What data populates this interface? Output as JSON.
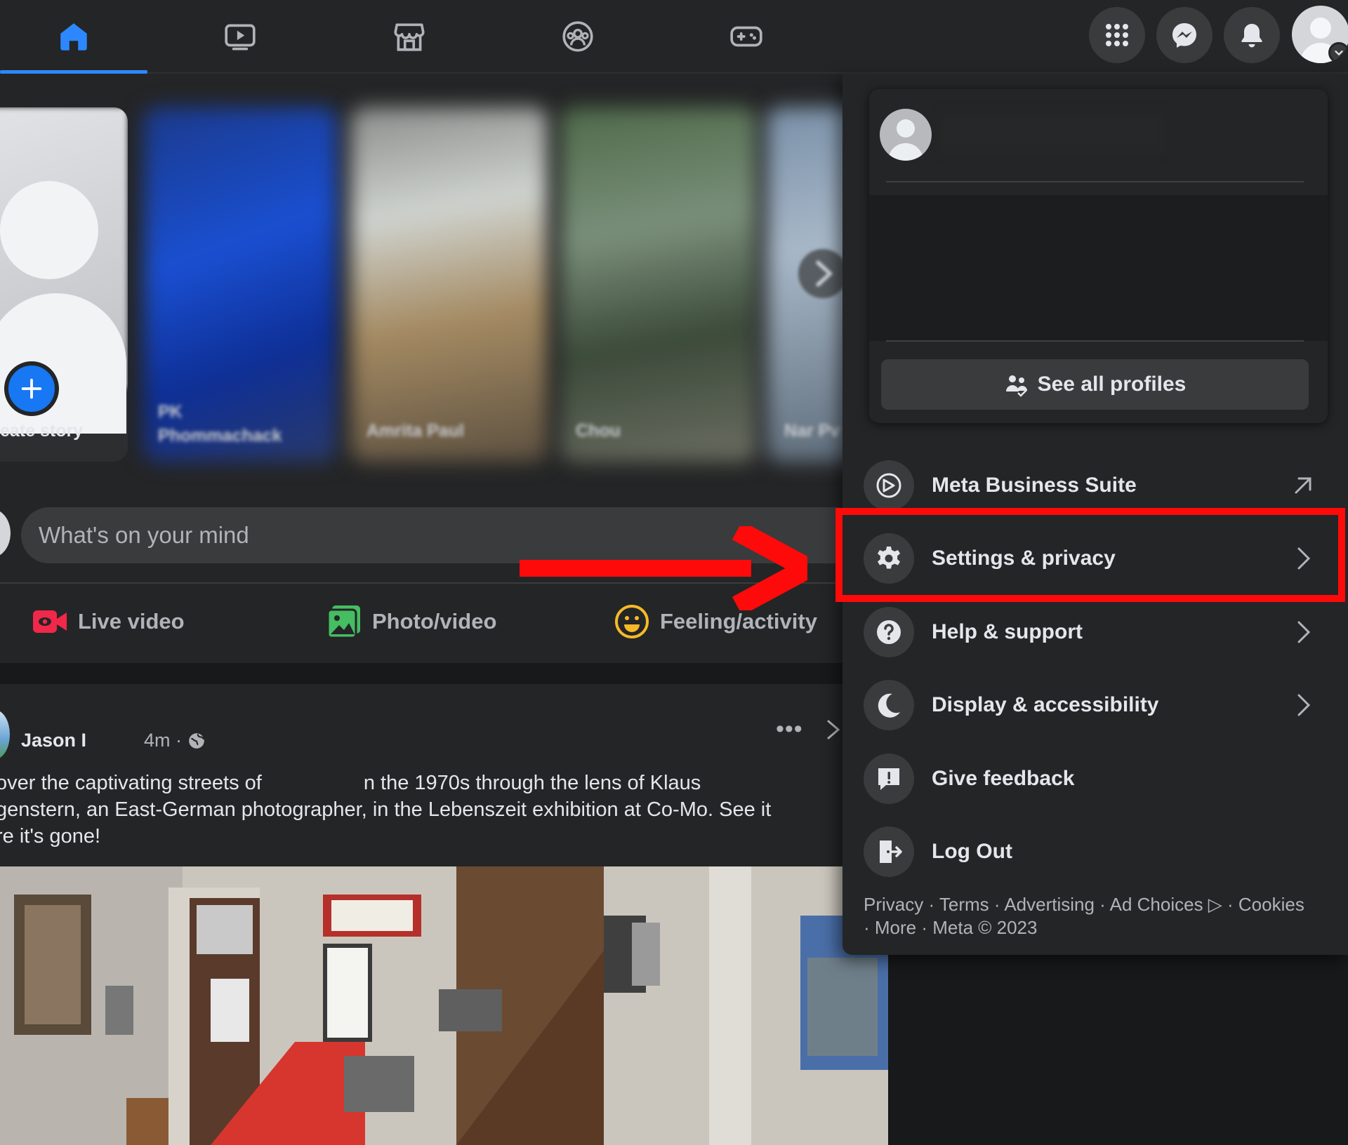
{
  "nav": {
    "tabs": [
      {
        "name": "home",
        "active": true
      },
      {
        "name": "watch",
        "active": false
      },
      {
        "name": "marketplace",
        "active": false
      },
      {
        "name": "groups",
        "active": false
      },
      {
        "name": "gaming",
        "active": false
      }
    ],
    "right_buttons": [
      "menu-grid-icon",
      "messenger-icon",
      "notifications-bell-icon",
      "account-avatar"
    ]
  },
  "stories": {
    "create_label": "eate story",
    "names": [
      "PK\nPhommachack",
      "Amrita Paul",
      "Chou",
      "Nar Pv"
    ]
  },
  "composer": {
    "placeholder": "What's on your mind",
    "actions": [
      {
        "label": "Live video",
        "icon": "live-video-icon",
        "color": "#f02849"
      },
      {
        "label": "Photo/video",
        "icon": "photo-video-icon",
        "color": "#45bd62"
      },
      {
        "label": "Feeling/activity",
        "icon": "feeling-icon",
        "color": "#f7b928"
      }
    ]
  },
  "post": {
    "author": "Jason I",
    "time": "4m ·",
    "more": "•••",
    "text": "over the captivating streets of                  n the 1970s through the lens of Klaus\ngenstern, an East-German photographer, in the Lebenszeit exhibition at Co-Mo. See it\nre it's gone!"
  },
  "menu": {
    "see_all_profiles": "See all profiles",
    "items": [
      {
        "label": "Meta Business Suite",
        "icon": "meta-business-suite-icon",
        "trail": "external-arrow-icon"
      },
      {
        "label": "Settings & privacy",
        "icon": "settings-gear-icon",
        "trail": "chevron-right-icon"
      },
      {
        "label": "Help & support",
        "icon": "help-question-icon",
        "trail": "chevron-right-icon"
      },
      {
        "label": "Display & accessibility",
        "icon": "moon-icon",
        "trail": "chevron-right-icon"
      },
      {
        "label": "Give feedback",
        "icon": "feedback-icon",
        "trail": ""
      },
      {
        "label": "Log Out",
        "icon": "logout-icon",
        "trail": ""
      }
    ],
    "footer": {
      "line1": "Privacy · Terms · Advertising · Ad Choices ▷ · Cookies",
      "line2": "· More · Meta © 2023"
    }
  },
  "colors": {
    "accent": "#2d88ff",
    "annotation": "#ff0a0a"
  }
}
